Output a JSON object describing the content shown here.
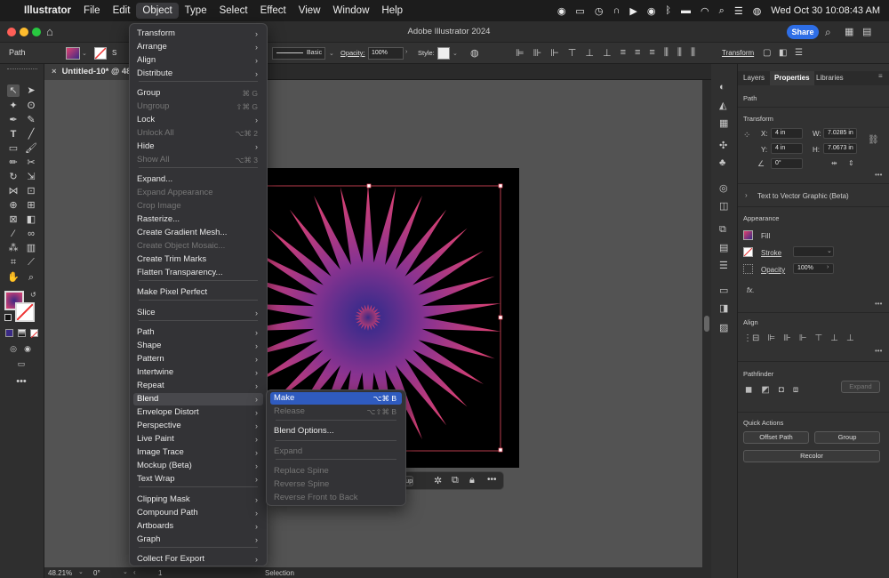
{
  "menubar": {
    "app": "Illustrator",
    "items": [
      "File",
      "Edit",
      "Object",
      "Type",
      "Select",
      "Effect",
      "View",
      "Window",
      "Help"
    ],
    "datetime": "Wed Oct 30  10:08:43 AM"
  },
  "window": {
    "title": "Adobe Illustrator 2024",
    "share_label": "Share"
  },
  "options": {
    "selection_type": "Path",
    "stroke_profile": "Basic",
    "opacity_label": "Opacity:",
    "opacity_value": "100%",
    "style_label": "Style:",
    "transform_label": "Transform"
  },
  "document": {
    "tab": "Untitled-10* @ 48.21"
  },
  "status": {
    "zoom": "48.21%",
    "rotation": "0°",
    "artboard": "1",
    "tool": "Selection"
  },
  "context_bar": {
    "partial_label": "up"
  },
  "object_menu": {
    "items": [
      {
        "label": "Transform",
        "arrow": true
      },
      {
        "label": "Arrange",
        "arrow": true
      },
      {
        "label": "Align",
        "arrow": true
      },
      {
        "label": "Distribute",
        "arrow": true
      },
      {
        "label": "Group",
        "shortcut": "⌘ G"
      },
      {
        "label": "Ungroup",
        "shortcut": "⇧⌘ G",
        "disabled": true
      },
      {
        "label": "Lock",
        "arrow": true
      },
      {
        "label": "Unlock All",
        "shortcut": "⌥⌘ 2",
        "disabled": true
      },
      {
        "label": "Hide",
        "arrow": true
      },
      {
        "label": "Show All",
        "shortcut": "⌥⌘ 3",
        "disabled": true
      },
      {
        "label": "Expand..."
      },
      {
        "label": "Expand Appearance",
        "disabled": true
      },
      {
        "label": "Crop Image",
        "disabled": true
      },
      {
        "label": "Rasterize..."
      },
      {
        "label": "Create Gradient Mesh..."
      },
      {
        "label": "Create Object Mosaic...",
        "disabled": true
      },
      {
        "label": "Create Trim Marks"
      },
      {
        "label": "Flatten Transparency..."
      },
      {
        "label": "Make Pixel Perfect"
      },
      {
        "label": "Slice",
        "arrow": true
      },
      {
        "label": "Path",
        "arrow": true
      },
      {
        "label": "Shape",
        "arrow": true
      },
      {
        "label": "Pattern",
        "arrow": true
      },
      {
        "label": "Intertwine",
        "arrow": true
      },
      {
        "label": "Repeat",
        "arrow": true
      },
      {
        "label": "Blend",
        "arrow": true
      },
      {
        "label": "Envelope Distort",
        "arrow": true
      },
      {
        "label": "Perspective",
        "arrow": true
      },
      {
        "label": "Live Paint",
        "arrow": true
      },
      {
        "label": "Image Trace",
        "arrow": true
      },
      {
        "label": "Mockup (Beta)",
        "arrow": true
      },
      {
        "label": "Text Wrap",
        "arrow": true
      },
      {
        "label": "Clipping Mask",
        "arrow": true
      },
      {
        "label": "Compound Path",
        "arrow": true
      },
      {
        "label": "Artboards",
        "arrow": true
      },
      {
        "label": "Graph",
        "arrow": true
      },
      {
        "label": "Collect For Export",
        "arrow": true
      }
    ]
  },
  "blend_menu": {
    "items": [
      {
        "label": "Make",
        "shortcut": "⌥⌘ B"
      },
      {
        "label": "Release",
        "shortcut": "⌥⇧⌘ B",
        "disabled": true
      },
      {
        "label": "Blend Options..."
      },
      {
        "label": "Expand",
        "disabled": true
      },
      {
        "label": "Replace Spine",
        "disabled": true
      },
      {
        "label": "Reverse Spine",
        "disabled": true
      },
      {
        "label": "Reverse Front to Back",
        "disabled": true
      }
    ]
  },
  "panel": {
    "tabs": [
      "Layers",
      "Properties",
      "Libraries"
    ],
    "selection": "Path",
    "transform": {
      "title": "Transform",
      "x_label": "X:",
      "x": "4 in",
      "y_label": "Y:",
      "y": "4 in",
      "w_label": "W:",
      "w": "7.0285 in",
      "h_label": "H:",
      "h": "7.0673 in",
      "angle": "0°"
    },
    "text_to_vector": "Text to Vector Graphic (Beta)",
    "appearance": {
      "title": "Appearance",
      "fill": "Fill",
      "stroke": "Stroke",
      "opacity": "Opacity",
      "opacity_value": "100%"
    },
    "fx": "fx.",
    "align_title": "Align",
    "pathfinder": {
      "title": "Pathfinder",
      "expand": "Expand"
    },
    "quick_actions": {
      "title": "Quick Actions",
      "offset_path": "Offset Path",
      "group": "Group",
      "recolor": "Recolor"
    }
  },
  "colors": {
    "menu_highlight": "#2f5bbf",
    "star_pink": "#e0426f",
    "star_purple": "#3a2a85",
    "artboard": "#000000",
    "selection": "#e84a5f"
  }
}
